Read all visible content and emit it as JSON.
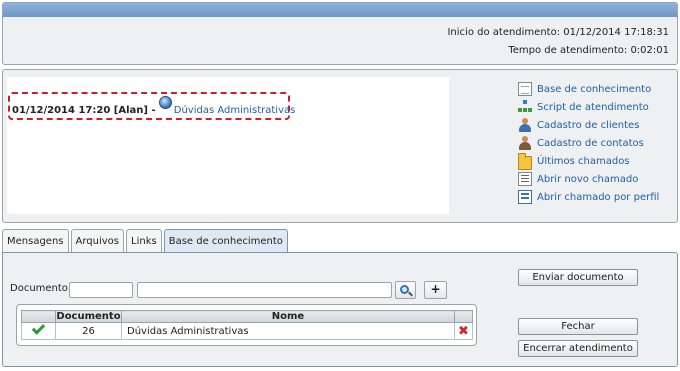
{
  "header": {
    "start_label": "Inicio do atendimento:",
    "start_value": "01/12/2014 17:18:31",
    "elapsed_label": "Tempo de atendimento:",
    "elapsed_value": "0:02:01"
  },
  "history": {
    "entry_meta": "01/12/2014 17:20 [Alan] -",
    "entry_link": "Dúvidas Administrativas"
  },
  "actions": [
    {
      "label": "Base de conhecimento",
      "icon": "document-icon"
    },
    {
      "label": "Script de atendimento",
      "icon": "tree-icon"
    },
    {
      "label": "Cadastro de clientes",
      "icon": "user-icon"
    },
    {
      "label": "Cadastro de contatos",
      "icon": "contact-icon"
    },
    {
      "label": "Últimos chamados",
      "icon": "folder-icon"
    },
    {
      "label": "Abrir novo chamado",
      "icon": "new-ticket-icon"
    },
    {
      "label": "Abrir chamado por perfil",
      "icon": "profile-list-icon"
    }
  ],
  "tabs": [
    {
      "label": "Mensagens",
      "active": false
    },
    {
      "label": "Arquivos",
      "active": false
    },
    {
      "label": "Links",
      "active": false
    },
    {
      "label": "Base de conhecimento",
      "active": true
    }
  ],
  "document_panel": {
    "doc_label": "Documento:",
    "code_value": "",
    "name_value": "",
    "plus_label": "+",
    "table": {
      "headers": [
        "Documento",
        "Nome"
      ],
      "rows": [
        {
          "documento": "26",
          "nome": "Dúvidas Administrativas"
        }
      ]
    },
    "buttons": {
      "send": "Enviar documento",
      "close": "Fechar",
      "end": "Encerrar atendimento"
    }
  },
  "colors": {
    "link": "#1f5fa8",
    "highlight_border": "#cc1f2d",
    "header_stripe": "#7ea6d0"
  }
}
